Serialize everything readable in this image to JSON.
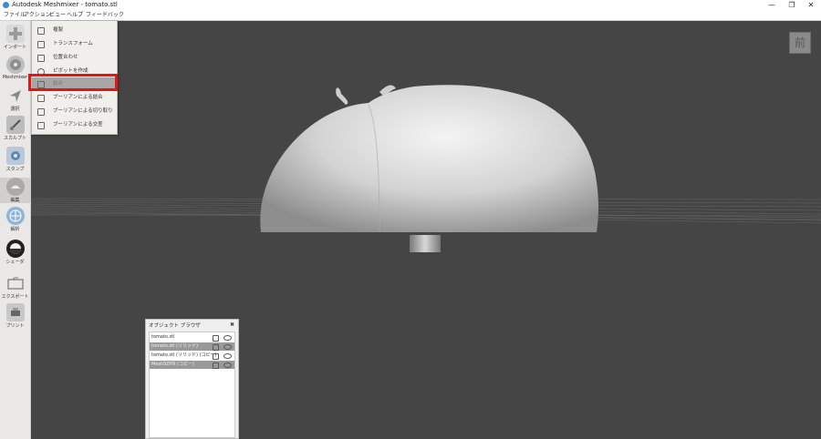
{
  "window": {
    "title": "Autodesk Meshmixer - tomato.stl",
    "minimize": "—",
    "maximize": "❐",
    "close": "✕"
  },
  "menu": [
    "ファイル",
    "アクション",
    "ビュー",
    "ヘルプ",
    "フィードバック"
  ],
  "toolbar": [
    {
      "label": "インポート",
      "icon": "plus-icon"
    },
    {
      "label": "Meshmixer",
      "icon": "meshmixer-icon"
    },
    {
      "label": "選択",
      "icon": "select-arrow-icon"
    },
    {
      "label": "スカルプト",
      "icon": "brush-icon"
    },
    {
      "label": "スタンプ",
      "icon": "stamp-icon"
    },
    {
      "label": "編集",
      "icon": "edit-icon"
    },
    {
      "label": "解析",
      "icon": "analysis-icon"
    },
    {
      "label": "シェーダ",
      "icon": "shader-sphere-icon"
    },
    {
      "label": "エクスポート",
      "icon": "export-folder-icon"
    },
    {
      "label": "プリント",
      "icon": "printer-icon"
    }
  ],
  "dropdown": [
    {
      "label": "複製",
      "icon": "duplicate-icon",
      "disabled": false
    },
    {
      "label": "トランスフォーム",
      "icon": "transform-icon",
      "disabled": false
    },
    {
      "label": "位置合わせ",
      "icon": "align-icon",
      "disabled": false
    },
    {
      "label": "ピボットを作成",
      "icon": "pivot-icon",
      "disabled": false
    },
    {
      "label": "結合",
      "icon": "combine-icon",
      "disabled": true
    },
    {
      "label": "ブーリアンによる結合",
      "icon": "boolean-union-icon",
      "disabled": false
    },
    {
      "label": "ブーリアンによる切り取り",
      "icon": "boolean-difference-icon",
      "disabled": false
    },
    {
      "label": "ブーリアンによる交差",
      "icon": "boolean-intersection-icon",
      "disabled": false
    }
  ],
  "navcube": {
    "label": "前"
  },
  "object_browser": {
    "title": "オブジェクト ブラウザ",
    "close": "✖",
    "items": [
      {
        "name": "tomato.stl",
        "selected": false
      },
      {
        "name": "tomato.stl (ソリッド)",
        "selected": true
      },
      {
        "name": "tomato.stl (ソリッド) (コピー)",
        "selected": false
      },
      {
        "name": "MeshSDYR (コピー)",
        "selected": true
      }
    ]
  }
}
